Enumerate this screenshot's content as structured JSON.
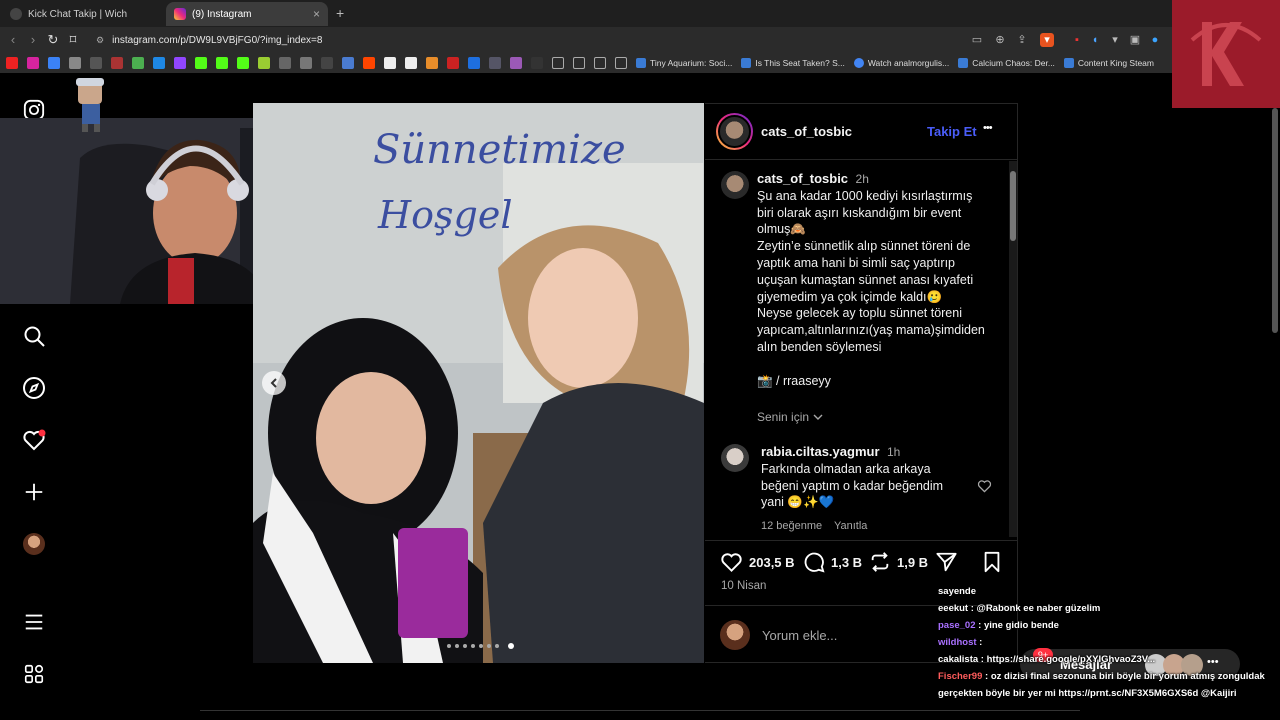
{
  "browser": {
    "tabs": [
      {
        "title": "Kick Chat Takip | Wich",
        "active": false
      },
      {
        "title": "(9) Instagram",
        "active": true
      }
    ],
    "new_tab": "+",
    "close_glyph": "×",
    "url": "instagram.com/p/DW9L9VBjFG0/?img_index=8",
    "bookmarks": [
      {
        "label": "Tiny Aquarium: Soci..."
      },
      {
        "label": "Is This Seat Taken? S..."
      },
      {
        "label": "Watch analmorgulis..."
      },
      {
        "label": "Calcium Chaos: Der..."
      },
      {
        "label": "Content King Steam"
      }
    ]
  },
  "post": {
    "image_text": [
      "Sünnetimize",
      "Hoşgel"
    ],
    "author": "cats_of_tosbic",
    "follow_label": "Takip Et",
    "more": "•••",
    "caption_time": "2h",
    "caption_lines": [
      "Şu ana kadar 1000 kediyi  kısırlaştırmış",
      "biri olarak aşırı kıskandığım bir event",
      "olmuş🙈",
      "Zeytin’e sünnetlik alıp sünnet töreni de",
      "yaptık ama hani bi simli saç yaptırıp",
      "uçuşan kumaştan sünnet anası kıyafeti",
      "giyemedim ya çok içimde kaldı🥲",
      "Neyse gelecek ay toplu sünnet töreni",
      "yapıcam,altınlarınızı(yaş mama)şimdiden",
      "alın  benden söylemesi"
    ],
    "credit": "📸 / rraaseyy",
    "translate_label": "Senin için",
    "comment": {
      "user": "rabia.ciltas.yagmur",
      "time": "1h",
      "lines": [
        "Farkında olmadan arka arkaya",
        "beğeni yaptım o kadar beğendim",
        "yani 😁✨💙"
      ],
      "likes": "12 beğenme",
      "reply": "Yanıtla"
    },
    "stats": {
      "likes": "203,5 B",
      "comments": "1,3 B",
      "reposts": "1,9 B"
    },
    "date": "10 Nisan",
    "comment_placeholder": "Yorum ekle..."
  },
  "messages_label": "Mesajlar",
  "messages_badge": "9+",
  "chat": [
    {
      "user": "",
      "text": "sayende",
      "user_color": "#ffffff"
    },
    {
      "user": "eeekut",
      "text": " : @Rabonk ee naber güzelim",
      "user_color": "#ffffff"
    },
    {
      "user": "pase_02",
      "text": " : yine gidio bende",
      "user_color": "#a970ff"
    },
    {
      "user": "wildhost",
      "text": " :",
      "user_color": "#a970ff"
    },
    {
      "user": "cakalista",
      "text": " : https://share.google/pXYIGhvaoZ3V...",
      "user_color": "#ffffff"
    },
    {
      "user": "Fischer99",
      "text": " : oz dizisi final sezonuna biri böyle bir yorum atmış zonguldak",
      "user_color": "#ff5c5c"
    },
    {
      "user": "",
      "text": "gerçekten böyle bir yer mi https://prnt.sc/NF3X5M6GXS6d @Kaijiri",
      "user_color": "#ffffff"
    }
  ],
  "colors": {
    "follow": "#4a5df9",
    "badge": "#ff3040",
    "accent_logo": "#9b1b2a"
  }
}
